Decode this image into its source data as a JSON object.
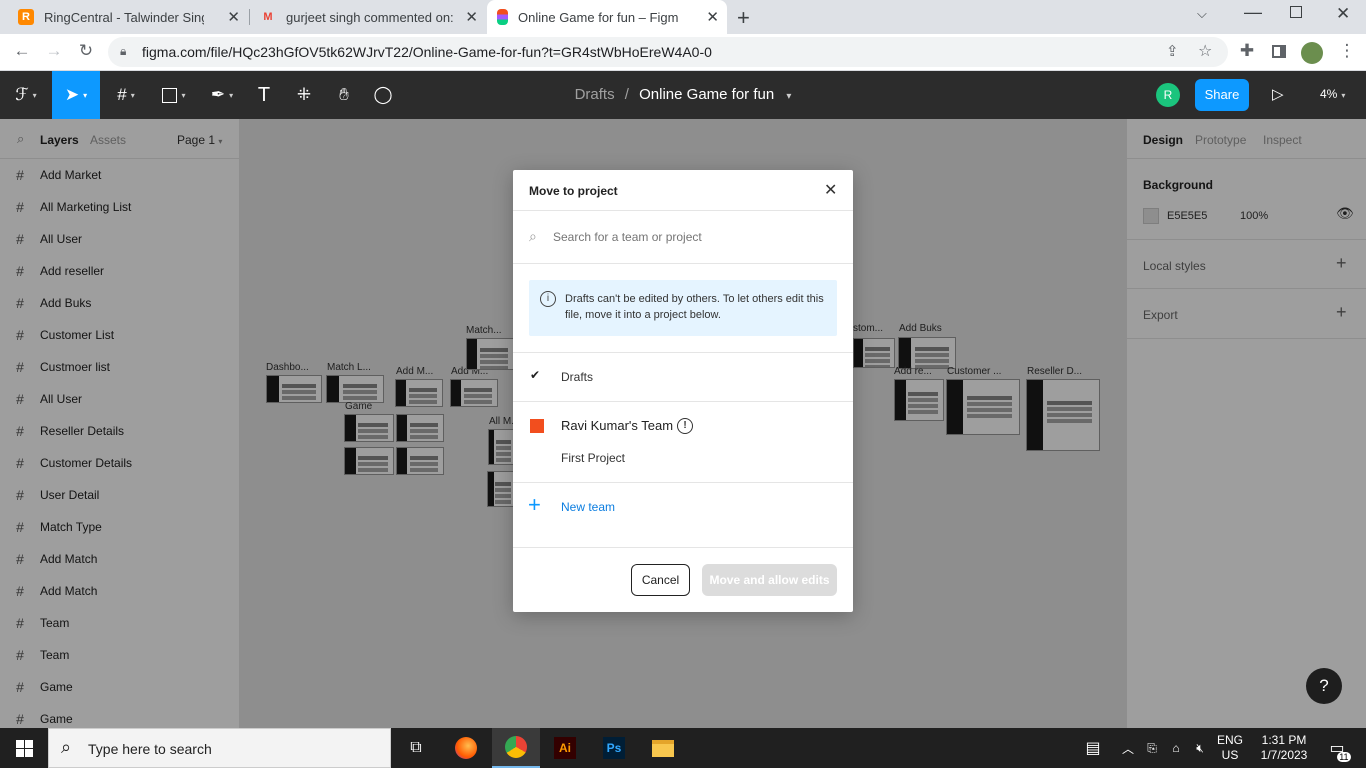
{
  "browser": {
    "tabs": [
      {
        "title": "RingCentral - Talwinder Singh",
        "favicon": "R"
      },
      {
        "title": "gurjeet singh commented on: \"Di",
        "favicon": "M"
      },
      {
        "title": "Online Game for fun – Figma",
        "favicon": "F"
      }
    ],
    "url": "figma.com/file/HQc23hGfOV5tk62WJrvT22/Online-Game-for-fun?t=GR4stWbHoEreW4A0-0"
  },
  "figma": {
    "breadcrumb_parent": "Drafts",
    "breadcrumb_sep": "/",
    "file_name": "Online Game for fun",
    "avatar_initial": "R",
    "share_label": "Share",
    "zoom": "4%"
  },
  "left_panel": {
    "tab_layers": "Layers",
    "tab_assets": "Assets",
    "page": "Page 1",
    "layers": [
      "Add Market",
      "All Marketing List",
      "All User",
      "Add reseller",
      "Add Buks",
      "Customer List",
      "Custmoer list",
      "All User",
      "Reseller Details",
      "Customer Details",
      "User Detail",
      "Match Type",
      "Add Match",
      "Add Match",
      "Team",
      "Team",
      "Game",
      "Game"
    ]
  },
  "canvas": {
    "frame_labels": [
      "Dashbo...",
      "Match L...",
      "Add M...",
      "Add M...",
      "Match...",
      "Game",
      "All M...",
      "stom...",
      "Add Buks",
      "Add re...",
      "Customer ...",
      "Reseller D..."
    ]
  },
  "right_panel": {
    "tab_design": "Design",
    "tab_prototype": "Prototype",
    "tab_inspect": "Inspect",
    "background_title": "Background",
    "bg_hex": "E5E5E5",
    "bg_opacity": "100%",
    "local_styles": "Local styles",
    "export": "Export",
    "bg_color": "#E5E5E5"
  },
  "modal": {
    "title": "Move to project",
    "search_placeholder": "Search for a team or project",
    "info_text": "Drafts can't be edited by others. To let others edit this file, move it into a project below.",
    "drafts_label": "Drafts",
    "team_name": "Ravi Kumar's Team",
    "project_name": "First Project",
    "new_team": "New team",
    "cancel": "Cancel",
    "confirm": "Move and allow edits",
    "team_color": "#F24E1E"
  },
  "help_label": "?",
  "taskbar": {
    "search_placeholder": "Type here to search",
    "lang": "ENG",
    "region": "US",
    "time": "1:31 PM",
    "date": "1/7/2023",
    "notification_count": "11"
  }
}
